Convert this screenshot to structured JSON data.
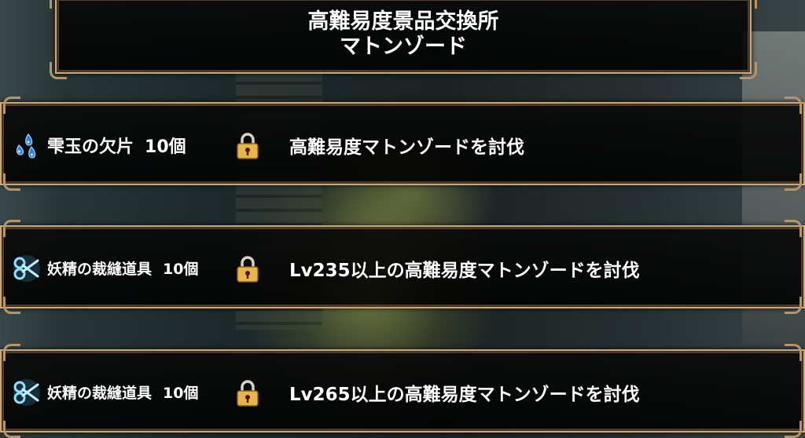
{
  "header": {
    "title_line1": "高難易度景品交換所",
    "title_line2": "マトンゾード"
  },
  "rewards": [
    {
      "icon": "teardrop-gem-icon",
      "name": "雫玉の欠片",
      "count": "10個",
      "lock_icon": "padlock-icon",
      "condition": "高難易度マトンゾードを討伐"
    },
    {
      "icon": "scissors-icon",
      "name": "妖精の裁縫道具",
      "count": "10個",
      "lock_icon": "padlock-icon",
      "condition": "Lv235以上の高難易度マトンゾードを討伐"
    },
    {
      "icon": "scissors-icon",
      "name": "妖精の裁縫道具",
      "count": "10個",
      "lock_icon": "padlock-icon",
      "condition": "Lv265以上の高難易度マトンゾードを討伐"
    }
  ],
  "colors": {
    "frame_gold": "#c9a97a",
    "lock_gold": "#e8b84a",
    "gem_blue": "#4aa8ff",
    "tool_cyan": "#7fd8ff"
  }
}
